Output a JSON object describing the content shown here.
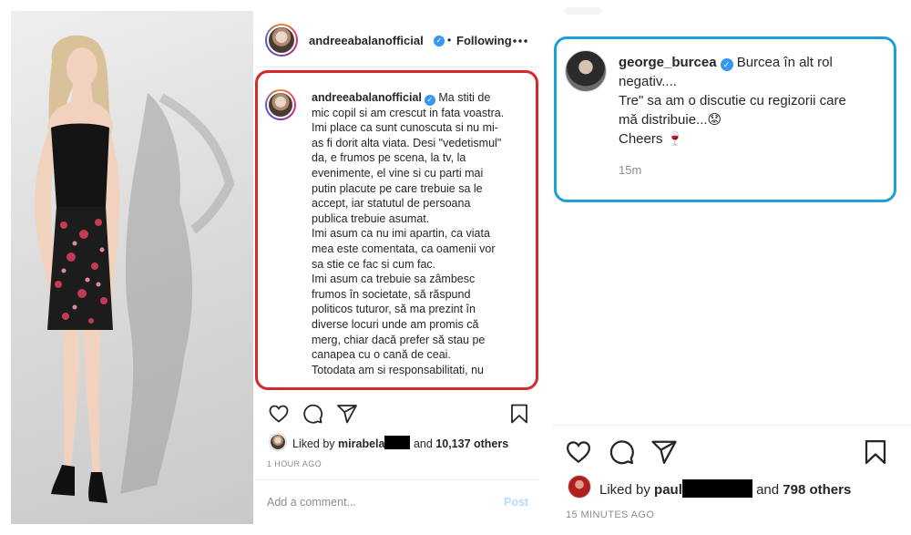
{
  "left_post": {
    "username": "andreeabalanofficial",
    "verified_mark": "✓",
    "separator": "•",
    "follow_status": "Following",
    "more_icon": "more-horizontal-icon",
    "caption_username": "andreeabalanofficial",
    "caption_lines": [
      "Ma stiti de",
      "mic copil si am crescut in fata voastra.",
      "Imi place ca sunt cunoscuta si nu mi-",
      "as fi dorit alta viata. Desi \"vedetismul\"",
      "da, e frumos pe scena, la tv, la",
      "evenimente, el vine si cu parti mai",
      "putin placute pe care trebuie sa le",
      "accept, iar statutul de persoana",
      "publica trebuie asumat.",
      "Imi asum ca nu imi apartin, ca viata",
      "mea este comentata, ca oamenii vor",
      "sa stie ce fac si cum fac.",
      "Imi asum ca trebuie sa zâmbesc",
      "frumos în societate, să răspund",
      "politicos tuturor, să ma prezint în",
      "diverse locuri unde am promis că",
      "merg, chiar dacă prefer să stau pe",
      "canapea cu o cană de ceai.",
      "Totodata am si responsabilitati, nu"
    ],
    "liked_by_prefix": "Liked by",
    "liked_by_user": "mirabela",
    "liked_and": "and",
    "liked_count": "10,137 others",
    "time_ago": "1 HOUR AGO",
    "comment_placeholder": "Add a comment...",
    "post_button": "Post"
  },
  "right_post": {
    "username": "george_burcea",
    "verified_mark": "✓",
    "caption_lines": [
      "Burcea în alt rol",
      "negativ....",
      "Tre\" sa am o discutie cu regizorii care",
      "mă distribuie...😟",
      "Cheers 🍷"
    ],
    "comment_time": "15m",
    "liked_by_prefix": "Liked by",
    "liked_by_user": "paul",
    "liked_and": "and",
    "liked_count": "798 others",
    "time_ago": "15 MINUTES AGO"
  },
  "colors": {
    "red_highlight": "#d62828",
    "blue_highlight": "#1d9fd8",
    "verified_blue": "#3897f0",
    "muted_text": "#8e8e8e",
    "post_button": "#b3dbff"
  },
  "icons": [
    "heart-icon",
    "comment-icon",
    "share-icon",
    "bookmark-icon",
    "more-horizontal-icon",
    "verified-badge-icon"
  ]
}
